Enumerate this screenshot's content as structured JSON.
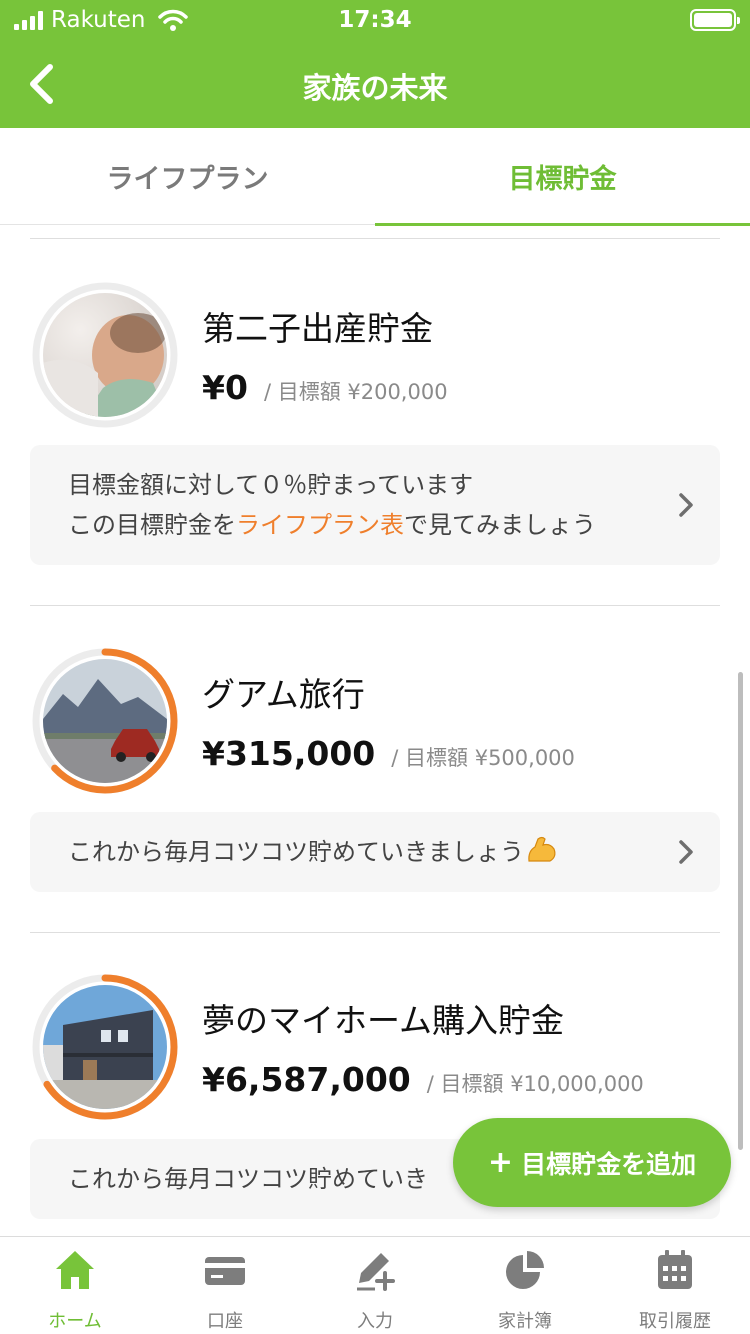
{
  "status_bar": {
    "carrier": "Rakuten",
    "time": "17:34"
  },
  "nav": {
    "title": "家族の未来",
    "back_icon": "chevron-left-icon"
  },
  "tabs": [
    {
      "label": "ライフプラン",
      "active": false
    },
    {
      "label": "目標貯金",
      "active": true
    }
  ],
  "goals": [
    {
      "name": "第二子出産貯金",
      "amount": "¥0",
      "target": "/ 目標額 ¥200,000",
      "progress_fraction": 0,
      "photo": "baby-photo",
      "message": {
        "line1": "目標金額に対して０％貯まっています",
        "line2_pre": "この目標貯金を",
        "line2_link": "ライフプラン表",
        "line2_post": "で見てみましょう"
      }
    },
    {
      "name": "グアム旅行",
      "amount": "¥315,000",
      "target": "/ 目標額 ¥500,000",
      "progress_fraction": 0.63,
      "photo": "car-road-photo",
      "message": {
        "text": "これから毎月コツコツ貯めていきましょう",
        "emoji": "flexed-biceps-icon"
      }
    },
    {
      "name": "夢のマイホーム購入貯金",
      "amount": "¥6,587,000",
      "target": "/ 目標額 ¥10,000,000",
      "progress_fraction": 0.6587,
      "photo": "house-photo",
      "message": {
        "text": "これから毎月コツコツ貯めていき"
      }
    }
  ],
  "fab": {
    "plus": "+",
    "label": "目標貯金を追加"
  },
  "bottom_tabs": [
    {
      "label": "ホーム",
      "icon": "home-icon",
      "active": true
    },
    {
      "label": "口座",
      "icon": "card-icon",
      "active": false
    },
    {
      "label": "入力",
      "icon": "pen-plus-icon",
      "active": false
    },
    {
      "label": "家計簿",
      "icon": "pie-chart-icon",
      "active": false
    },
    {
      "label": "取引履歴",
      "icon": "calendar-icon",
      "active": false
    }
  ],
  "colors": {
    "brand_green": "#78c43a",
    "progress_orange": "#ef7f2c",
    "ring_track": "#ececec"
  }
}
